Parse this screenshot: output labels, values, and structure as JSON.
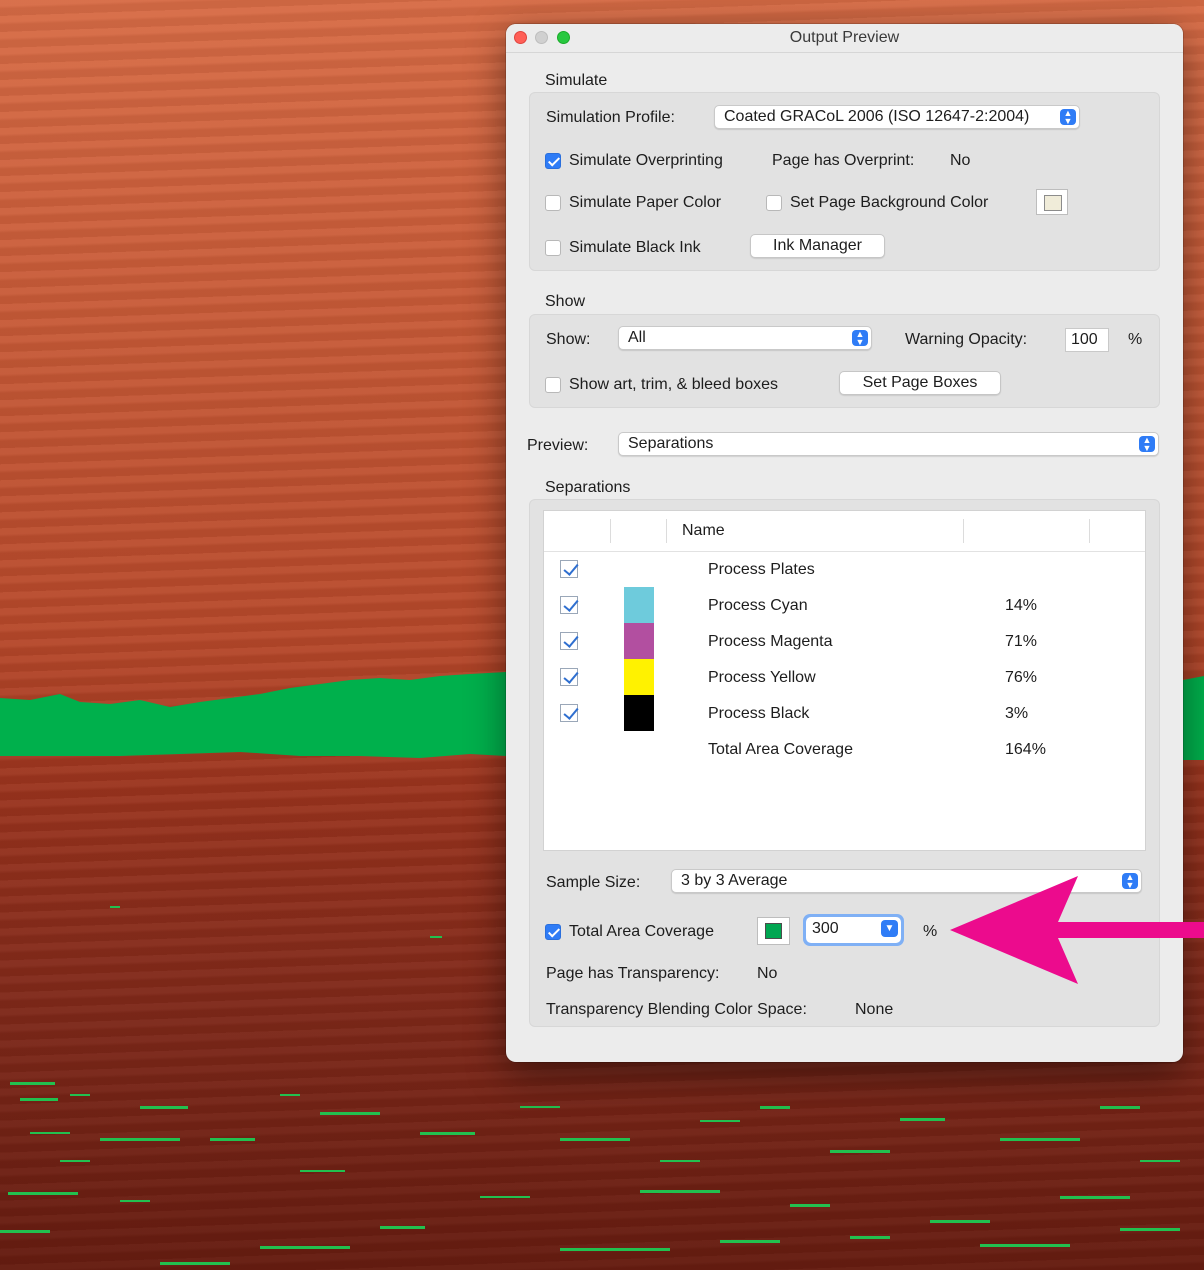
{
  "window": {
    "title": "Output Preview"
  },
  "simulate": {
    "section_label": "Simulate",
    "profile_label": "Simulation Profile:",
    "profile_value": "Coated GRACoL 2006 (ISO 12647-2:2004)",
    "overprinting_label": "Simulate Overprinting",
    "overprinting_checked": true,
    "page_overprint_label": "Page has Overprint:",
    "page_overprint_value": "No",
    "paper_color_label": "Simulate Paper Color",
    "page_bg_label": "Set Page Background Color",
    "black_ink_label": "Simulate Black Ink",
    "ink_manager_button": "Ink Manager"
  },
  "show": {
    "section_label": "Show",
    "show_label": "Show:",
    "show_value": "All",
    "warning_label": "Warning Opacity:",
    "warning_value": "100",
    "warning_unit": "%",
    "boxes_label": "Show art, trim, & bleed boxes",
    "set_boxes_button": "Set Page Boxes"
  },
  "preview": {
    "label": "Preview:",
    "value": "Separations"
  },
  "separations": {
    "section_label": "Separations",
    "column_name": "Name",
    "rows": [
      {
        "name": "Process Plates",
        "value": "",
        "checked": true,
        "color": ""
      },
      {
        "name": "Process Cyan",
        "value": "14%",
        "checked": true,
        "color": "#6ecbdc"
      },
      {
        "name": "Process Magenta",
        "value": "71%",
        "checked": true,
        "color": "#b24fa0"
      },
      {
        "name": "Process Yellow",
        "value": "76%",
        "checked": true,
        "color": "#fff200"
      },
      {
        "name": "Process Black",
        "value": "3%",
        "checked": true,
        "color": "#000000"
      },
      {
        "name": "Total Area Coverage",
        "value": "164%",
        "checked": false,
        "color": ""
      }
    ],
    "sample_size_label": "Sample Size:",
    "sample_size_value": "3 by 3 Average",
    "tac_label": "Total Area Coverage",
    "tac_checked": true,
    "tac_color": "#00a651",
    "tac_value": "300",
    "tac_unit": "%",
    "transparency_label": "Page has Transparency:",
    "transparency_value": "No",
    "blending_label": "Transparency Blending Color Space:",
    "blending_value": "None"
  },
  "annotation": {
    "arrow_color": "#ec0b8d"
  },
  "background": {
    "highlight_color": "#00b04c"
  }
}
